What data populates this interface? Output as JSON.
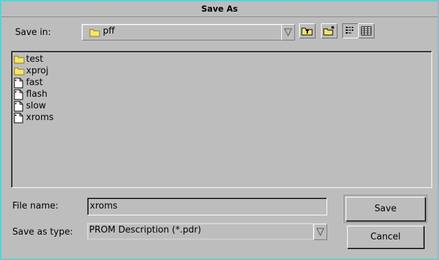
{
  "window": {
    "title": "Save As"
  },
  "top": {
    "save_in_label": "Save in:",
    "save_in_value": "pff"
  },
  "files": [
    {
      "name": "test",
      "type": "folder"
    },
    {
      "name": "xproj",
      "type": "folder"
    },
    {
      "name": "fast",
      "type": "file"
    },
    {
      "name": "flash",
      "type": "file"
    },
    {
      "name": "slow",
      "type": "file"
    },
    {
      "name": "xroms",
      "type": "file"
    }
  ],
  "bottom": {
    "file_name_label": "File name:",
    "file_name_value": "xroms",
    "save_type_label": "Save as type:",
    "save_type_value": "PROM Description (*.pdr)"
  },
  "buttons": {
    "save": "Save",
    "cancel": "Cancel"
  },
  "icons": {
    "folder": "folder-icon",
    "file": "file-icon",
    "up": "up-folder-icon",
    "new": "new-folder-icon",
    "list": "list-view-icon",
    "details": "details-view-icon",
    "dropdown": "chevron-down-icon"
  },
  "colors": {
    "background": "#bdbdbd",
    "frame": "#5fd0d0",
    "folder": "#f5e66a"
  }
}
